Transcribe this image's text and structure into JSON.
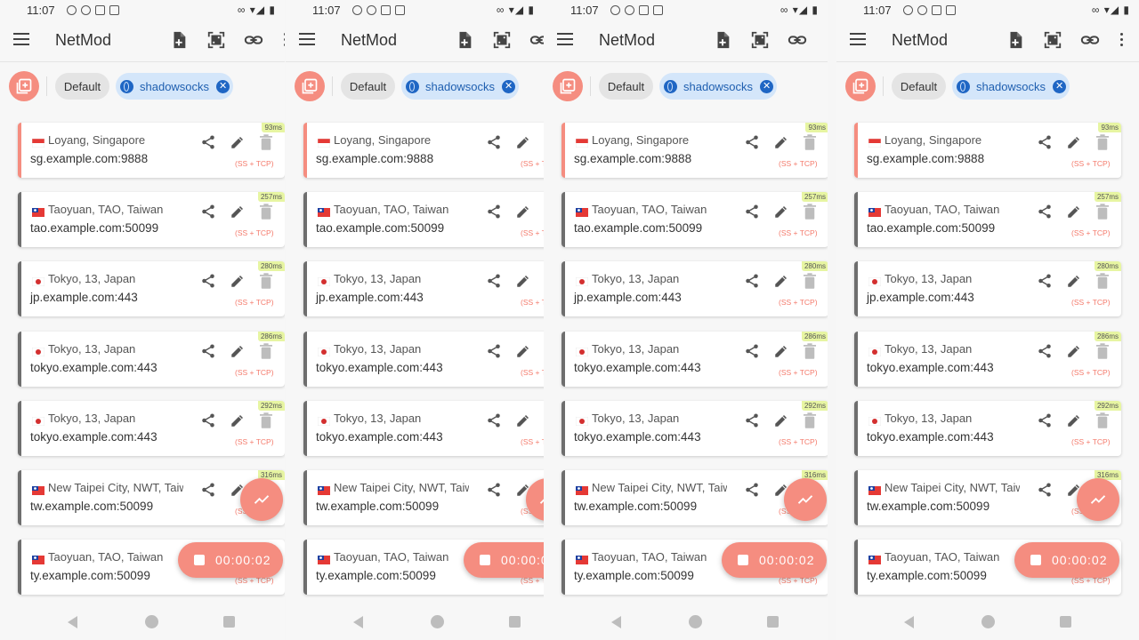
{
  "status": {
    "time": "11:07",
    "right": "∞ ▾◢ ▮"
  },
  "app": {
    "title": "NetMod"
  },
  "chips": {
    "default": "Default",
    "shadowsocks": "shadowsocks",
    "remove": "✕"
  },
  "servers": [
    {
      "location": "Loyang, Singapore",
      "host": "sg.example.com:9888",
      "protocol": "(SS + TCP)",
      "latency": "93ms",
      "flag": "sg",
      "active": true
    },
    {
      "location": "Taoyuan, TAO, Taiwan",
      "host": "tao.example.com:50099",
      "protocol": "(SS + TCP)",
      "latency": "257ms",
      "flag": "tw",
      "active": false
    },
    {
      "location": "Tokyo, 13, Japan",
      "host": "jp.example.com:443",
      "protocol": "(SS + TCP)",
      "latency": "280ms",
      "flag": "jp",
      "active": false
    },
    {
      "location": "Tokyo, 13, Japan",
      "host": "tokyo.example.com:443",
      "protocol": "(SS + TCP)",
      "latency": "286ms",
      "flag": "jp",
      "active": false
    },
    {
      "location": "Tokyo, 13, Japan",
      "host": "tokyo.example.com:443",
      "protocol": "(SS + TCP)",
      "latency": "292ms",
      "flag": "jp",
      "active": false
    },
    {
      "location": "New Taipei City, NWT, Taiwan",
      "host": "tw.example.com:50099",
      "protocol": "(SS + TCP)",
      "latency": "316ms",
      "flag": "tw",
      "active": false
    },
    {
      "location": "Taoyuan, TAO, Taiwan",
      "host": "ty.example.com:50099",
      "protocol": "(SS + TCP)",
      "latency": "",
      "flag": "tw",
      "active": false
    }
  ],
  "timer": {
    "elapsed": "00:00:02"
  },
  "icons": {
    "menu": "menu-icon",
    "add_file": "add-file-icon",
    "qr": "qr-scan-icon",
    "link": "link-icon",
    "more": "more-vert-icon",
    "add_group": "add-group-icon",
    "share": "share-icon",
    "edit": "edit-icon",
    "delete": "delete-icon",
    "speed": "speed-test-icon",
    "stop": "stop-icon"
  },
  "colors": {
    "accent": "#f58d80",
    "chip_blue": "#d4e6fa",
    "latency_badge": "#e7f5a2",
    "protocol_text": "#f47a6b"
  }
}
